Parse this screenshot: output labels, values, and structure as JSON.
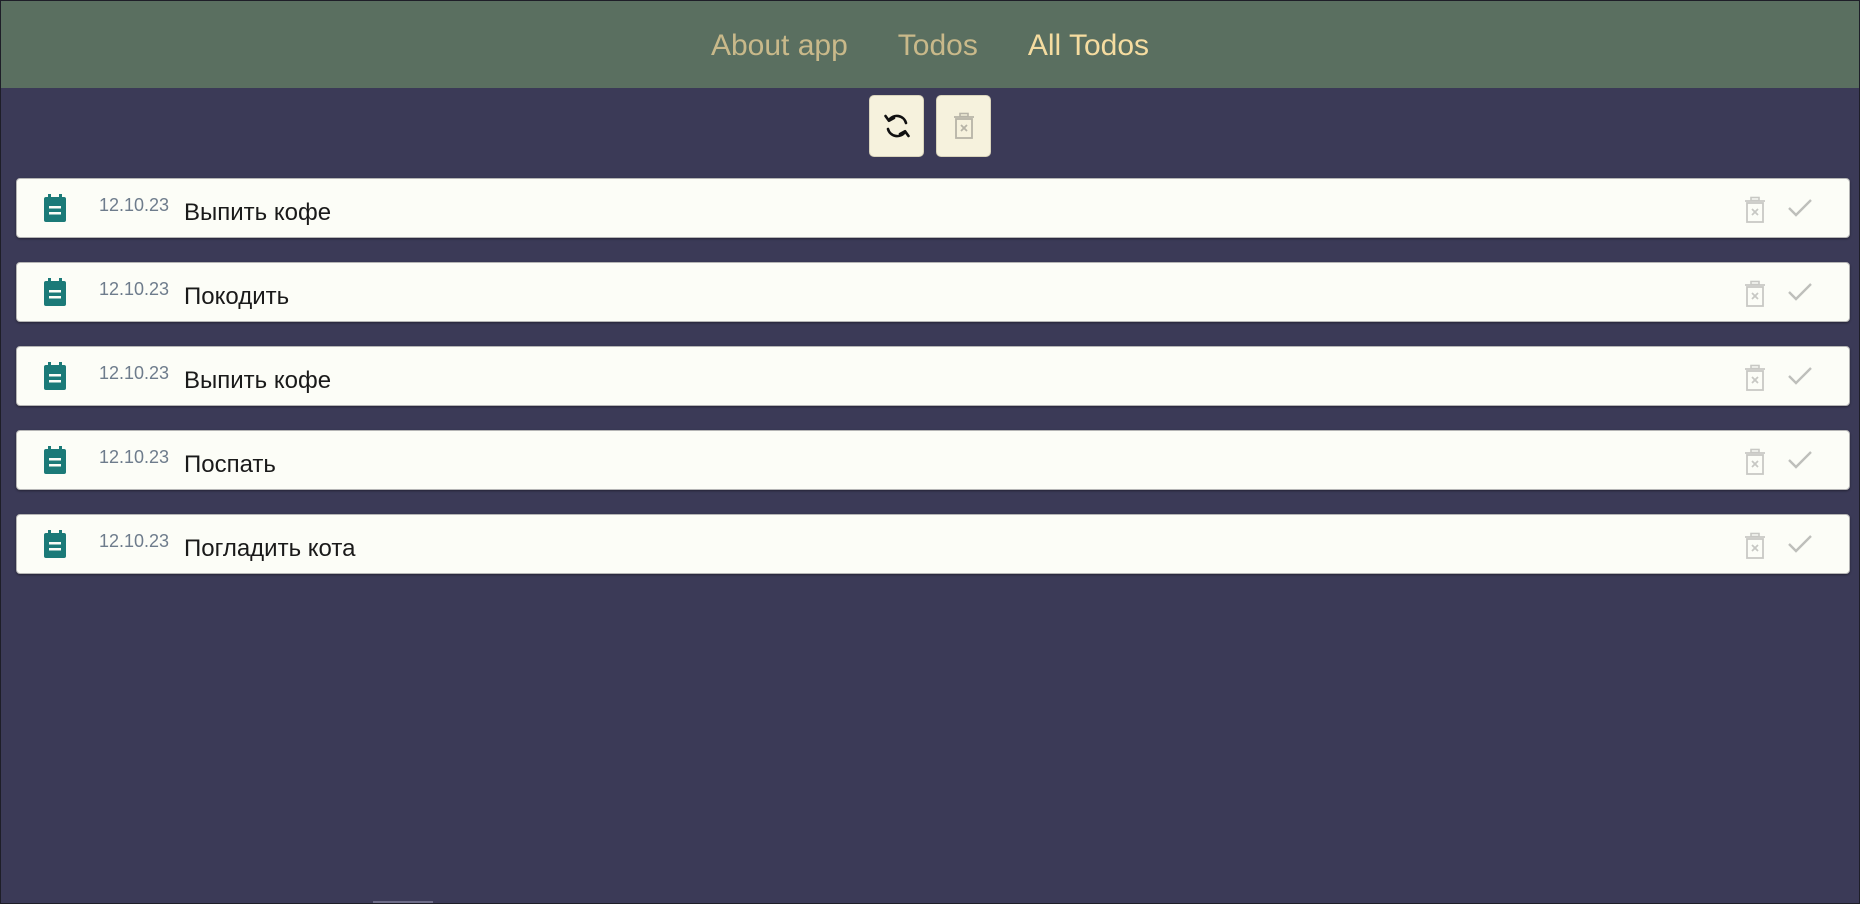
{
  "nav": {
    "links": [
      {
        "label": "About app",
        "active": false
      },
      {
        "label": "Todos",
        "active": false
      },
      {
        "label": "All Todos",
        "active": true
      }
    ]
  },
  "toolbar": {
    "refresh_icon": "refresh-icon",
    "clear_icon": "trash-icon"
  },
  "colors": {
    "background": "#3b3a57",
    "nav_background": "#5a6f60",
    "nav_link": "#c9b98a",
    "nav_link_active": "#f5dca0",
    "card_background": "#fcfdf7",
    "note_icon": "#1b7a78"
  },
  "todos": [
    {
      "date": "12.10.23",
      "text": "Выпить кофе"
    },
    {
      "date": "12.10.23",
      "text": "Покодить"
    },
    {
      "date": "12.10.23",
      "text": "Выпить кофе"
    },
    {
      "date": "12.10.23",
      "text": "Поспать"
    },
    {
      "date": "12.10.23",
      "text": "Погладить кота"
    }
  ]
}
